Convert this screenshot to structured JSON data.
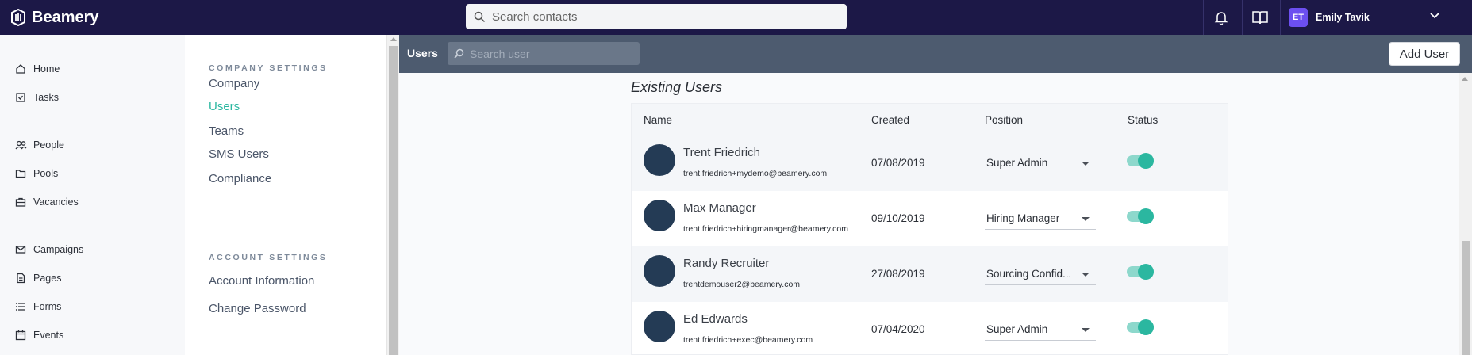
{
  "topbar": {
    "brand": "Beamery",
    "search_placeholder": "Search contacts",
    "user_initials": "ET",
    "user_name": "Emily Tavik"
  },
  "nav": {
    "items": [
      {
        "label": "Home",
        "icon": "home-icon"
      },
      {
        "label": "Tasks",
        "icon": "tasks-icon"
      },
      {
        "label": "People",
        "icon": "people-icon"
      },
      {
        "label": "Pools",
        "icon": "folder-icon"
      },
      {
        "label": "Vacancies",
        "icon": "briefcase-icon"
      },
      {
        "label": "Campaigns",
        "icon": "envelope-icon"
      },
      {
        "label": "Pages",
        "icon": "page-icon"
      },
      {
        "label": "Forms",
        "icon": "list-icon"
      },
      {
        "label": "Events",
        "icon": "calendar-icon"
      }
    ]
  },
  "settings": {
    "company_title": "COMPANY SETTINGS",
    "company_items": [
      "Company",
      "Users",
      "Teams",
      "SMS Users",
      "Compliance"
    ],
    "active_item": "Users",
    "account_title": "ACCOUNT SETTINGS",
    "account_items": [
      "Account Information",
      "Change Password"
    ]
  },
  "users_bar": {
    "label": "Users",
    "search_placeholder": "Search user",
    "add_button": "Add User"
  },
  "existing": {
    "title": "Existing Users",
    "columns": [
      "Name",
      "Created",
      "Position",
      "Status"
    ],
    "rows": [
      {
        "name": "Trent Friedrich",
        "email": "trent.friedrich+mydemo@beamery.com",
        "created": "07/08/2019",
        "position": "Super Admin",
        "status": true
      },
      {
        "name": "Max Manager",
        "email": "trent.friedrich+hiringmanager@beamery.com",
        "created": "09/10/2019",
        "position": "Hiring Manager",
        "status": true
      },
      {
        "name": "Randy Recruiter",
        "email": "trentdemouser2@beamery.com",
        "created": "27/08/2019",
        "position": "Sourcing Confid...",
        "status": true
      },
      {
        "name": "Ed Edwards",
        "email": "trent.friedrich+exec@beamery.com",
        "created": "07/04/2020",
        "position": "Super Admin",
        "status": true
      }
    ]
  },
  "colors": {
    "topbar": "#1c1847",
    "accent": "#2bb7a0",
    "users_bar": "#4d5b6f",
    "avatar": "#243b55"
  }
}
